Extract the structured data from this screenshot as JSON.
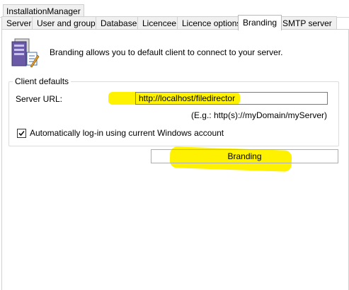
{
  "window": {
    "title": "InstallationManager"
  },
  "tabs": [
    {
      "label": "Server",
      "active": false
    },
    {
      "label": "User and groups",
      "active": false
    },
    {
      "label": "Database",
      "active": false
    },
    {
      "label": "Licencee",
      "active": false
    },
    {
      "label": "Licence options",
      "active": false
    },
    {
      "label": "Branding",
      "active": true
    },
    {
      "label": "SMTP server",
      "active": false
    }
  ],
  "header": {
    "icon": "server-settings-icon",
    "description": "Branding allows you to default client to connect to your server."
  },
  "client_defaults": {
    "title": "Client defaults",
    "server_url_label": "Server URL:",
    "server_url_value": "http://localhost/filedirector",
    "server_url_hint": "(E.g.: http(s)://myDomain/myServer)",
    "auto_login_label": "Automatically log-in using current Windows account",
    "auto_login_checked": true
  },
  "actions": {
    "branding_button": "Branding"
  },
  "colors": {
    "highlight": "#fff200"
  }
}
